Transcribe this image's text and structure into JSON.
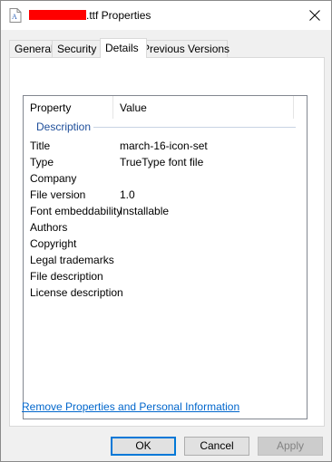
{
  "window": {
    "title_suffix": ".ttf Properties"
  },
  "tabs": [
    {
      "label": "General"
    },
    {
      "label": "Security"
    },
    {
      "label": "Details"
    },
    {
      "label": "Previous Versions"
    }
  ],
  "details": {
    "columns": {
      "property": "Property",
      "value": "Value"
    },
    "group": "Description",
    "rows": [
      {
        "property": "Title",
        "value": "march-16-icon-set"
      },
      {
        "property": "Type",
        "value": "TrueType font file"
      },
      {
        "property": "Company",
        "value": ""
      },
      {
        "property": "File version",
        "value": "1.0"
      },
      {
        "property": "Font embeddability",
        "value": "Installable"
      },
      {
        "property": "Authors",
        "value": ""
      },
      {
        "property": "Copyright",
        "value": ""
      },
      {
        "property": "Legal trademarks",
        "value": ""
      },
      {
        "property": "File description",
        "value": ""
      },
      {
        "property": "License description",
        "value": ""
      }
    ]
  },
  "link_text": "Remove Properties and Personal Information",
  "buttons": {
    "ok": "OK",
    "cancel": "Cancel",
    "apply": "Apply"
  },
  "colors": {
    "accent": "#0078d7",
    "link": "#0066cc",
    "group": "#1e4e9a",
    "redaction": "#ff0000"
  }
}
